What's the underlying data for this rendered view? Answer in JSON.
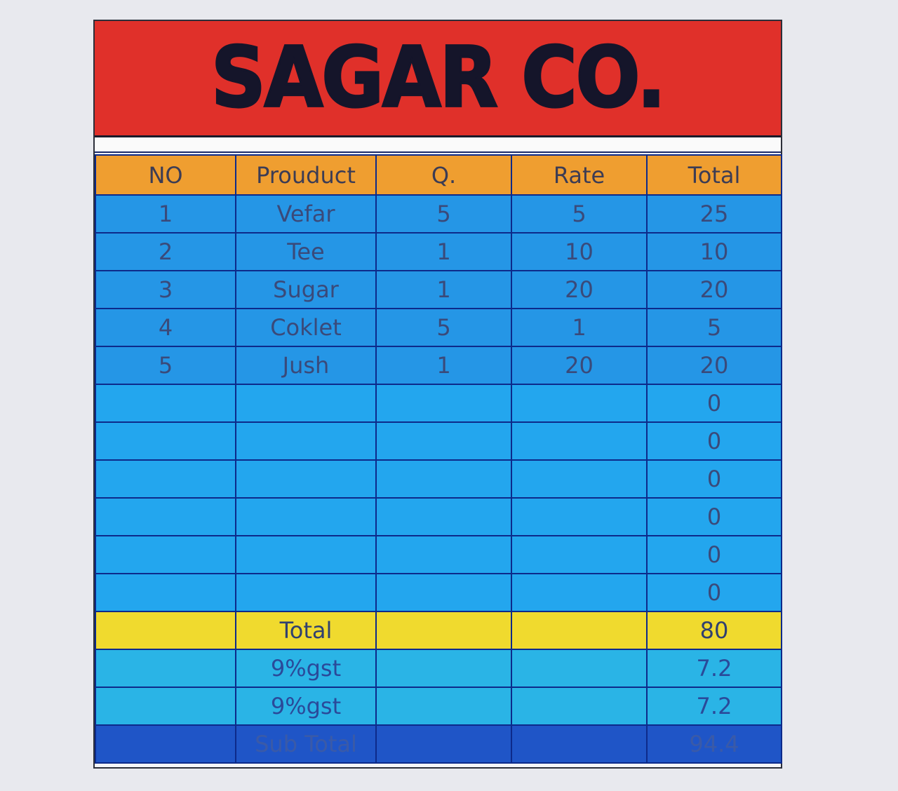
{
  "company": "SAGAR CO.",
  "headers": [
    "NO",
    "Prouduct",
    "Q.",
    "Rate",
    "Total"
  ],
  "items": [
    {
      "no": "1",
      "product": "Vefar",
      "qty": "5",
      "rate": "5",
      "total": "25"
    },
    {
      "no": "2",
      "product": "Tee",
      "qty": "1",
      "rate": "10",
      "total": "10"
    },
    {
      "no": "3",
      "product": "Sugar",
      "qty": "1",
      "rate": "20",
      "total": "20"
    },
    {
      "no": "4",
      "product": "Coklet",
      "qty": "5",
      "rate": "1",
      "total": "5"
    },
    {
      "no": "5",
      "product": "Jush",
      "qty": "1",
      "rate": "20",
      "total": "20"
    }
  ],
  "empty_totals": [
    "0",
    "0",
    "0",
    "0",
    "0",
    "0"
  ],
  "summary": [
    {
      "label": "Total",
      "value": "80",
      "kind": "total"
    },
    {
      "label": "9%gst",
      "value": "7.2",
      "kind": "gst"
    },
    {
      "label": "9%gst",
      "value": "7.2",
      "kind": "gst"
    },
    {
      "label": "Sub Total",
      "value": "94.4",
      "kind": "sub"
    }
  ],
  "colors": {
    "title_bg": "#e0302a",
    "header_bg": "#ef9e30",
    "item_bg": "#2596e6",
    "total_bg": "#f0da2e",
    "subtotal_bg": "#1f55c7"
  }
}
